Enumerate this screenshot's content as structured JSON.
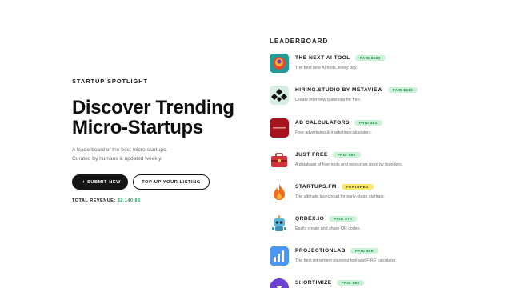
{
  "hero": {
    "eyebrow": "STARTUP SPOTLIGHT",
    "headline_line1": "Discover Trending",
    "headline_line2": "Micro-Startups",
    "sub_line1": "A leaderboard of the best micro-startups.",
    "sub_line2": "Curated by humans & updated weekly.",
    "submit_label": "+ SUBMIT NEW",
    "topup_label": "TOP-UP YOUR LISTING",
    "revenue_label": "TOTAL REVENUE:",
    "revenue_value": "$2,140.85"
  },
  "leaderboard": {
    "title": "LEADERBOARD",
    "entries": [
      {
        "name": "THE NEXT AI TOOL",
        "badge": "PAID $120",
        "badge_type": "paid",
        "desc": "The best new AI tools, every day.",
        "icon": "next-ai-tool-logo"
      },
      {
        "name": "HIRING.STUDIO BY METAVIEW",
        "badge": "PAID $110",
        "badge_type": "paid",
        "desc": "Create interview questions for free.",
        "icon": "hiring-studio-logo"
      },
      {
        "name": "AD CALCULATORS",
        "badge": "PAID $81",
        "badge_type": "paid",
        "desc": "Free advertising & marketing calculators.",
        "icon": "ad-calculators-logo"
      },
      {
        "name": "JUST FREE",
        "badge": "PAID $80",
        "badge_type": "paid",
        "desc": "A database of free tools and resources used by founders.",
        "icon": "toolbox-logo"
      },
      {
        "name": "STARTUPS.FM",
        "badge": "FEATURED",
        "badge_type": "featured",
        "desc": "The ultimate launchpad for early-stage startups.",
        "icon": "flame-logo"
      },
      {
        "name": "QRDEX.IO",
        "badge": "PAID $70",
        "badge_type": "paid",
        "desc": "Easily create and share QR codes.",
        "icon": "robot-logo"
      },
      {
        "name": "PROJECTIONLAB",
        "badge": "PAID $65",
        "badge_type": "paid",
        "desc": "The best retirement planning tool and FIRE calculator.",
        "icon": "bar-chart-logo"
      },
      {
        "name": "SHORTIMIZE",
        "badge": "PAID $60",
        "badge_type": "paid",
        "desc": "",
        "icon": "shortimize-logo"
      }
    ]
  },
  "colors": {
    "accent_green": "#22a55c",
    "badge_paid_bg": "#c9f2d6",
    "badge_featured_bg": "#fbe76a"
  }
}
